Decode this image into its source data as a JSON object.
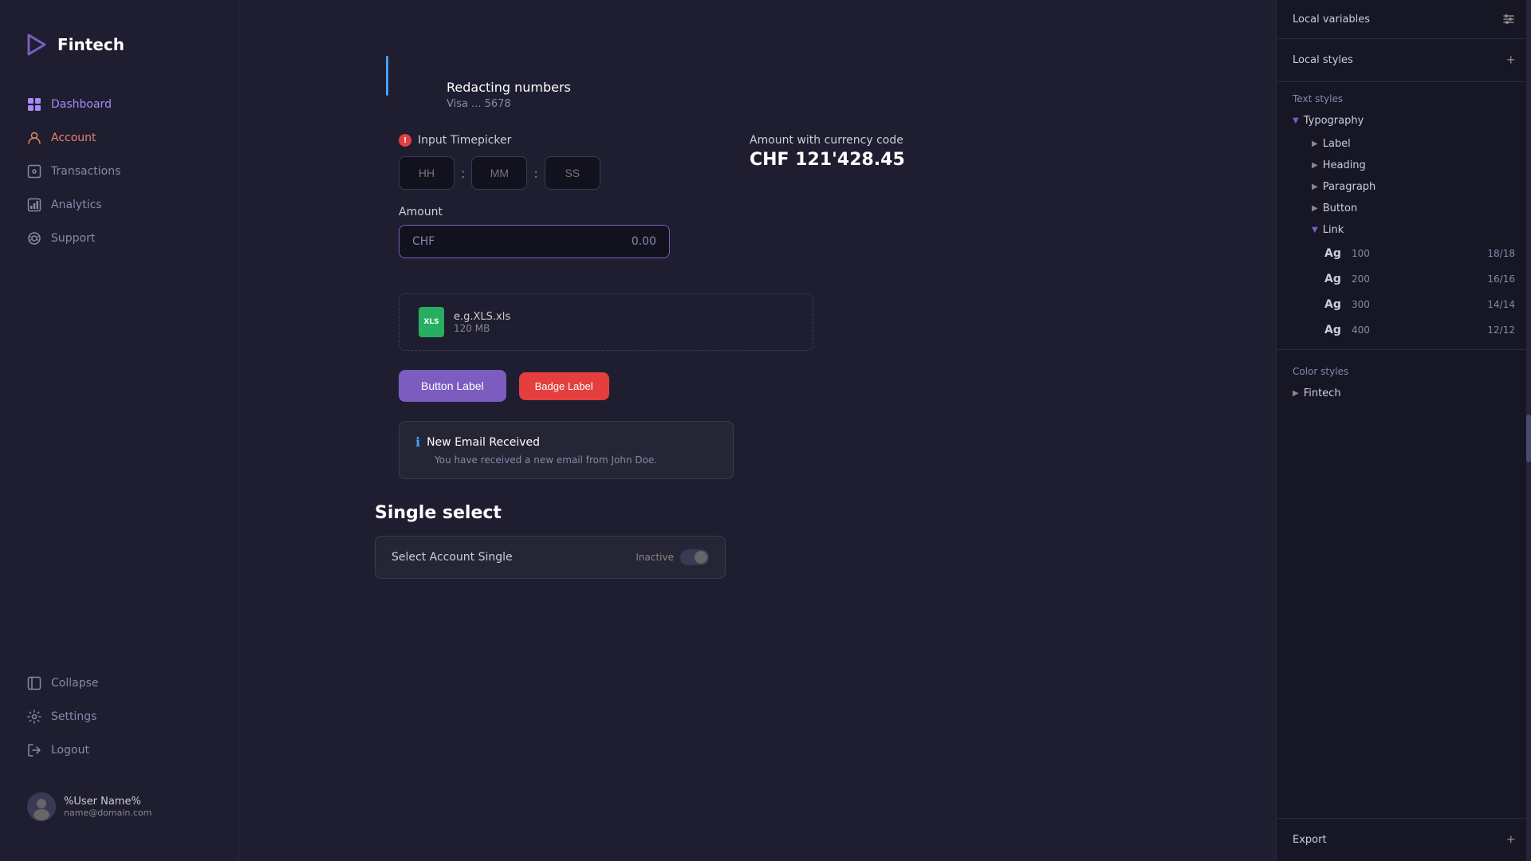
{
  "sidebar": {
    "logo_text": "Fintech",
    "nav_items": [
      {
        "id": "dashboard",
        "label": "Dashboard",
        "active": true
      },
      {
        "id": "account",
        "label": "Account",
        "active": false
      },
      {
        "id": "transactions",
        "label": "Transactions",
        "active": false
      },
      {
        "id": "analytics",
        "label": "Analytics",
        "active": false
      },
      {
        "id": "support",
        "label": "Support",
        "active": false
      }
    ],
    "bottom_items": [
      {
        "id": "collapse",
        "label": "Collapse"
      },
      {
        "id": "settings",
        "label": "Settings"
      },
      {
        "id": "logout",
        "label": "Logout"
      }
    ],
    "user": {
      "name": "%User Name%",
      "email": "name@domain.com"
    }
  },
  "main": {
    "redacting": {
      "title": "Redacting numbers",
      "subtitle": "Visa ... 5678"
    },
    "timepicker": {
      "label": "Input Timepicker",
      "hh": "HH",
      "mm": "MM",
      "ss": "SS"
    },
    "amount": {
      "label": "Amount",
      "currency": "CHF",
      "value": "0.00"
    },
    "currency_display": {
      "label": "Amount with currency code",
      "value": "CHF 121'428.45"
    },
    "file": {
      "name": "e.g.XLS.xls",
      "size": "120 MB"
    },
    "buttons": {
      "primary": "Button Label",
      "badge": "Badge Label"
    },
    "notification": {
      "title": "New Email Received",
      "body": "You have received a new email from John Doe."
    },
    "single_select": {
      "title": "Single select",
      "label": "Select Account Single",
      "status": "Inactive"
    }
  },
  "right_panel": {
    "local_variables_label": "Local variables",
    "local_styles_label": "Local styles",
    "text_styles_label": "Text styles",
    "typography_label": "Typography",
    "typography_items": [
      {
        "label": "Label"
      },
      {
        "label": "Heading"
      },
      {
        "label": "Paragraph"
      },
      {
        "label": "Button"
      }
    ],
    "link_label": "Link",
    "link_sub_items": [
      {
        "ag": "Ag",
        "weight": "100",
        "size": "18/18"
      },
      {
        "ag": "Ag",
        "weight": "200",
        "size": "16/16"
      },
      {
        "ag": "Ag",
        "weight": "300",
        "size": "14/14"
      },
      {
        "ag": "Ag",
        "weight": "400",
        "size": "12/12"
      }
    ],
    "color_styles_label": "Color styles",
    "fintech_label": "Fintech",
    "export_label": "Export"
  }
}
